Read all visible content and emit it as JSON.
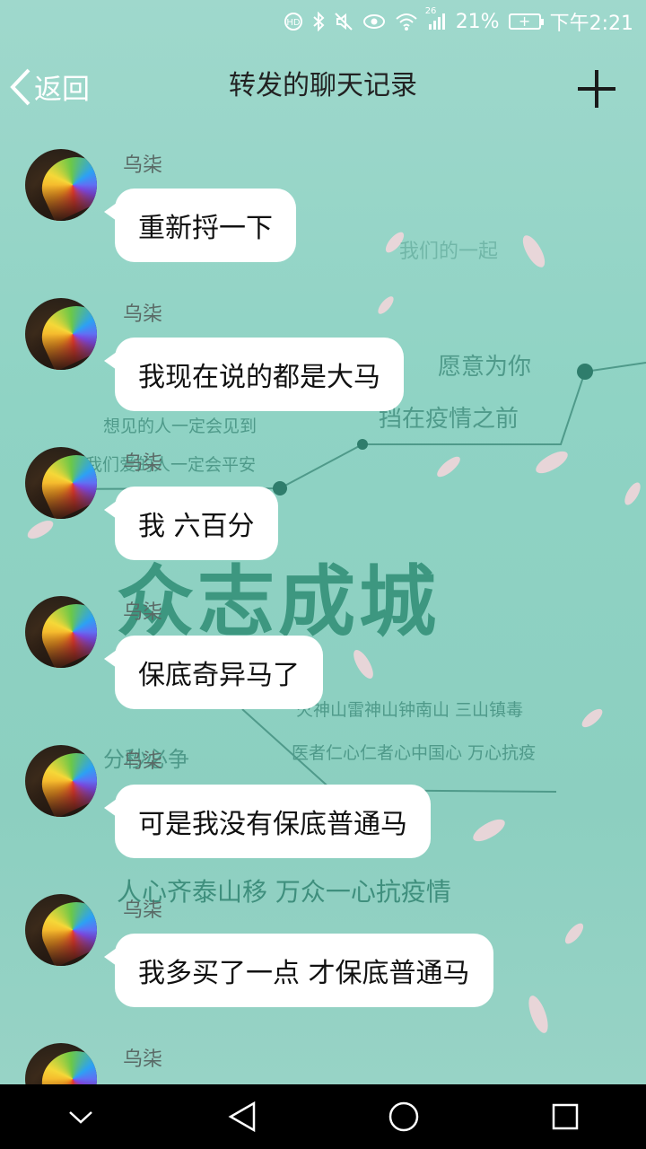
{
  "status_bar": {
    "battery": "21%",
    "time": "下午2:21",
    "network": "26"
  },
  "header": {
    "back_label": "返回",
    "title": "转发的聊天记录"
  },
  "background": {
    "line1": "我们的一起",
    "line2": "愿意为你",
    "line3": "挡在疫情之前",
    "line4": "想见的人一定会见到",
    "line5": "我们爱的人一定会平安",
    "slogan": "众志成城",
    "line6": "火神山雷神山钟南山 三山镇毒",
    "line7": "医者仁心仁者心中国心 万心抗疫",
    "line8": "分秒必争",
    "line9": "人心齐泰山移  万众一心抗疫情"
  },
  "messages": [
    {
      "sender": "乌柒",
      "text": "重新捋一下"
    },
    {
      "sender": "乌柒",
      "text": "我现在说的都是大马"
    },
    {
      "sender": "乌柒",
      "text": "我 六百分"
    },
    {
      "sender": "乌柒",
      "text": "保底奇异马了"
    },
    {
      "sender": "乌柒",
      "text": "可是我没有保底普通马"
    },
    {
      "sender": "乌柒",
      "text": "我多买了一点 才保底普通马"
    },
    {
      "sender": "乌柒",
      "text": ""
    }
  ]
}
